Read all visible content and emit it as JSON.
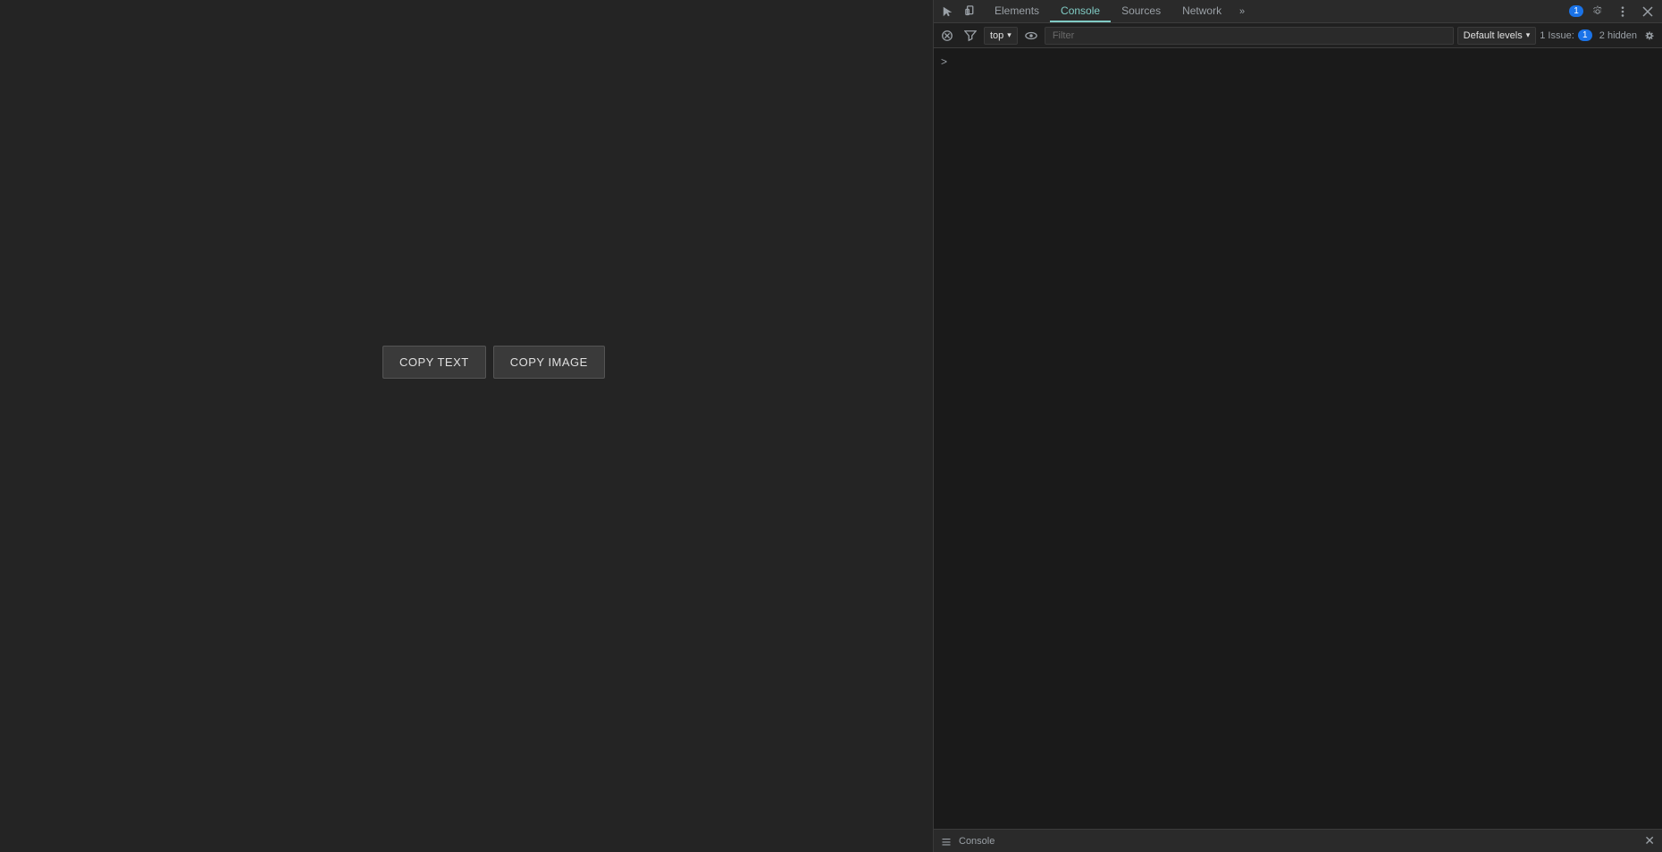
{
  "page": {
    "background_color": "#242424",
    "buttons": [
      {
        "label": "COPY TEXT",
        "id": "copy-text"
      },
      {
        "label": "COPY IMAGE",
        "id": "copy-image"
      }
    ]
  },
  "devtools": {
    "tabs": [
      {
        "label": "Elements",
        "active": false
      },
      {
        "label": "Console",
        "active": true
      },
      {
        "label": "Sources",
        "active": false
      },
      {
        "label": "Network",
        "active": false
      }
    ],
    "toolbar": {
      "more_tabs": "»",
      "settings_label": "⚙",
      "more_options": "⋮",
      "close": "✕",
      "badge_count": "1"
    },
    "secondary": {
      "context_label": "top",
      "context_arrow": "▾",
      "filter_placeholder": "Filter",
      "log_level": "Default levels",
      "log_level_arrow": "▾",
      "issue_label": "1 Issue:",
      "issue_count": "1",
      "hidden_count": "2 hidden",
      "settings_icon": "⚙"
    },
    "console_prompt": ">",
    "bottom": {
      "menu_icon": "≡",
      "console_label": "Console",
      "close": "✕"
    },
    "icons": {
      "inspect": "⬚",
      "device": "📱",
      "eye": "👁",
      "dock_left": "⬜",
      "dock_bottom": "⬜",
      "undock": "⬜",
      "clear": "🚫",
      "filter": "⊘"
    }
  }
}
